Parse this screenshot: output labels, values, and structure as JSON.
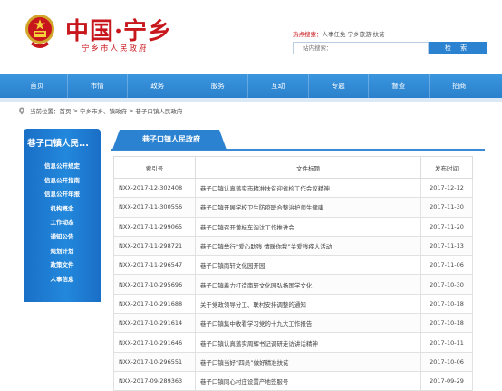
{
  "header": {
    "site_title": "中国·宁乡",
    "site_subtitle": "宁乡市人民政府",
    "hot_search_label": "热点搜索：",
    "hot_search_terms": "人事任免  宁乡旅游  扶贫",
    "search_placeholder": "站内搜索：",
    "search_button": "检 索",
    "emblem_icon": "national-emblem-icon",
    "brand_red": "#c8161d",
    "accent_blue": "#2a80cc"
  },
  "nav": {
    "items": [
      "首页",
      "市情",
      "政务",
      "服务",
      "互动",
      "专题",
      "督查",
      "招商"
    ]
  },
  "breadcrumb": {
    "prefix": "当前位置：",
    "items": [
      "首页",
      "宁乡市乡、镇政府",
      "巷子口镇人民政府"
    ]
  },
  "sidebar": {
    "title": "巷子口镇人民...",
    "items": [
      "信息公开规定",
      "信息公开指南",
      "信息公开年报",
      "机构概念",
      "工作动态",
      "通知公告",
      "规划计划",
      "政策文件",
      "人事信息"
    ]
  },
  "main": {
    "tab_label": "巷子口镇人民政府",
    "columns": [
      "索引号",
      "文件标题",
      "发布时间"
    ],
    "rows": [
      [
        "NXX-2017-12-302408",
        "巷子口镇认真落实市精准扶贫迎省检工作会议精神",
        "2017-12-12"
      ],
      [
        "NXX-2017-11-300556",
        "巷子口镇开展学校卫生防疫联合整治护师生健康",
        "2017-11-30"
      ],
      [
        "NXX-2017-11-299065",
        "巷子口镇召开黄标车淘汰工作推进会",
        "2017-11-20"
      ],
      [
        "NXX-2017-11-298721",
        "巷子口镇举行“爱心助残 情暖你我”关爱残疾人活动",
        "2017-11-13"
      ],
      [
        "NXX-2017-11-296547",
        "巷子口镇南轩文化园开园",
        "2017-11-06"
      ],
      [
        "NXX-2017-10-295696",
        "巷子口镇着力打造南轩文化园弘扬国学文化",
        "2017-10-30"
      ],
      [
        "NXX-2017-10-291688",
        "关于党政领导分工、联村安排调整的通知",
        "2017-10-18"
      ],
      [
        "NXX-2017-10-291614",
        "巷子口镇集中收看学习党的十九大工作报告",
        "2017-10-18"
      ],
      [
        "NXX-2017-10-291646",
        "巷子口镇认真落实周辉书记调研走访讲话精神",
        "2017-10-11"
      ],
      [
        "NXX-2017-10-296551",
        "巷子口镇当好“四员”做好精准扶贫",
        "2017-10-06"
      ],
      [
        "NXX-2017-09-289363",
        "巷子口镇同心村庄设置产地签服号",
        "2017-09-29"
      ]
    ]
  }
}
